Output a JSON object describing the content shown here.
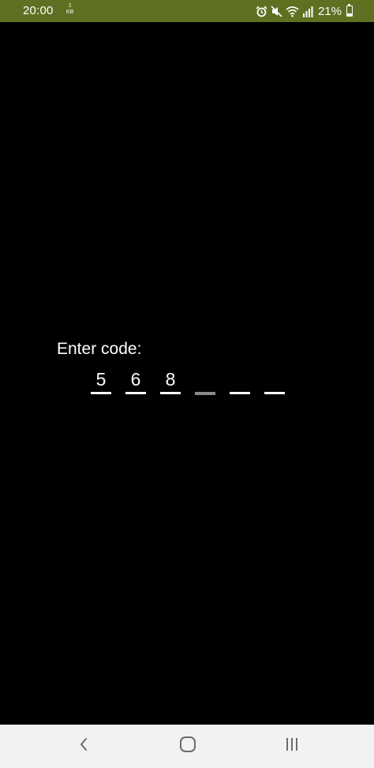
{
  "status_bar": {
    "time": "20:00",
    "net_speed_value": "1",
    "net_speed_unit": "KB",
    "battery_percent": "21%",
    "icons": [
      "alarm-icon",
      "mute-icon",
      "wifi-icon",
      "signal-icon",
      "battery-icon"
    ],
    "background_color": "#5f7022"
  },
  "code_entry": {
    "label": "Enter code:",
    "digits": [
      "5",
      "6",
      "8",
      "",
      "",
      ""
    ],
    "active_index": 3
  },
  "nav_bar": {
    "buttons": [
      "back-icon",
      "home-icon",
      "recents-icon"
    ]
  }
}
